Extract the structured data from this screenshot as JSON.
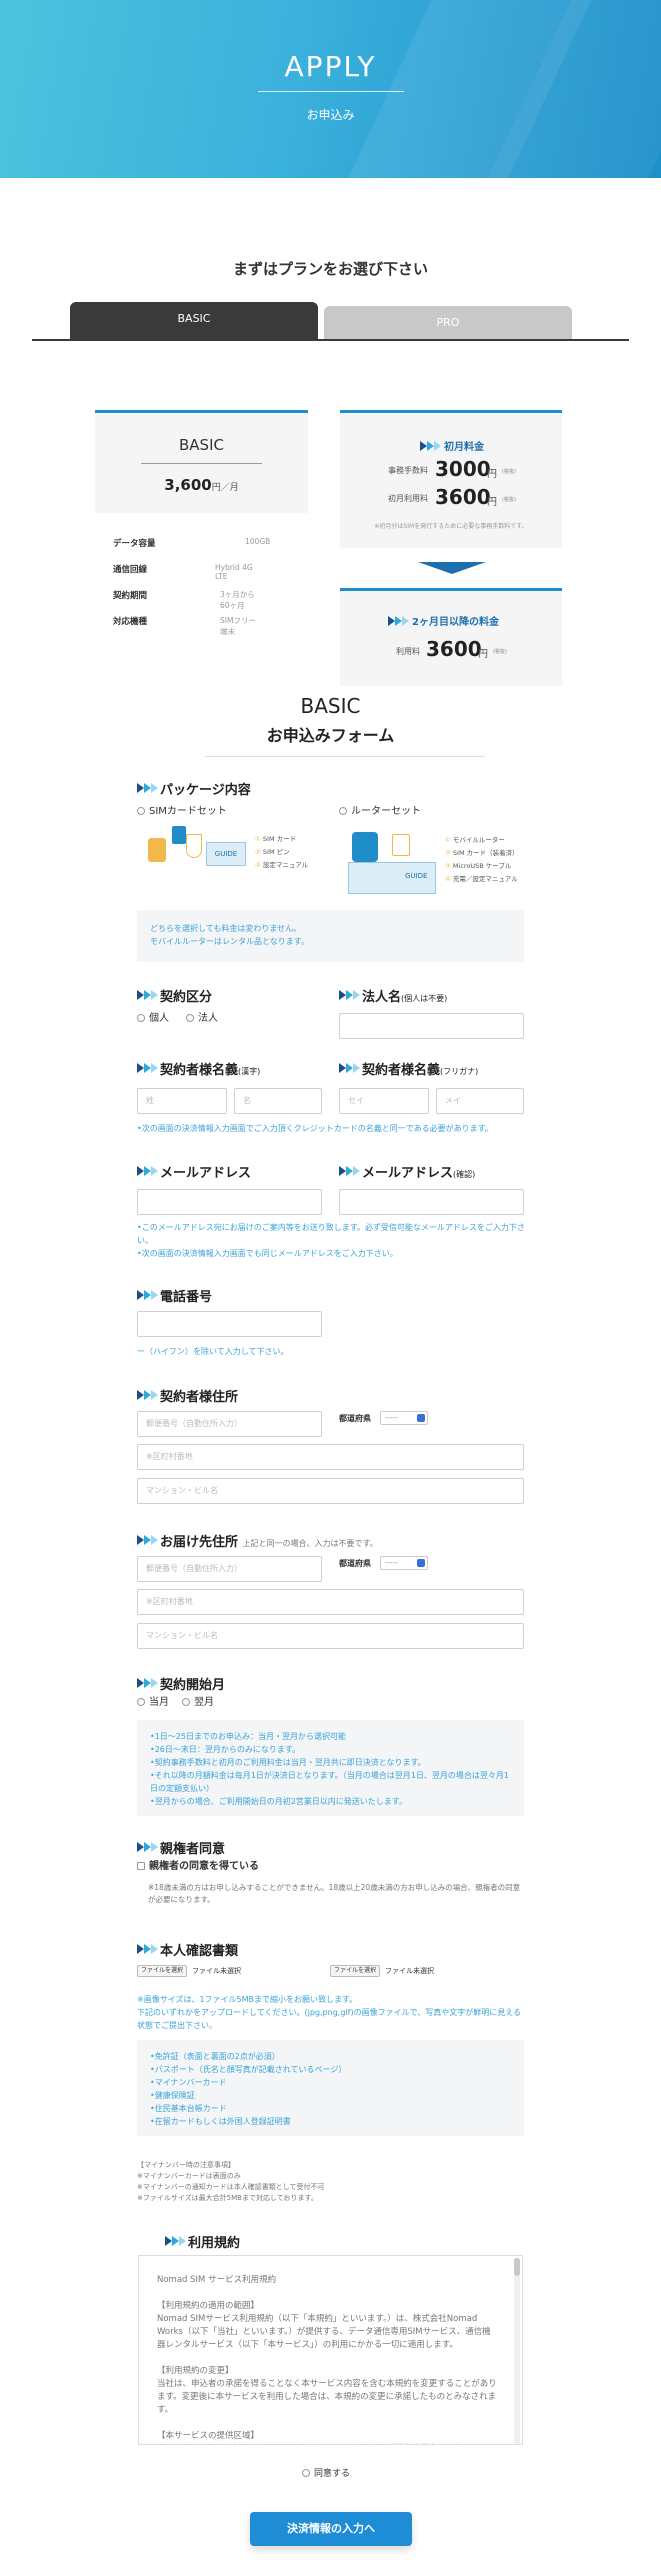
{
  "hero": {
    "title": "APPLY",
    "subtitle": "お申込み"
  },
  "plan_select": {
    "heading": "まずはプランをお選び下さい"
  },
  "tabs": [
    {
      "label": "BASIC"
    },
    {
      "label": "PRO"
    }
  ],
  "plan_card": {
    "name": "BASIC",
    "price": "3,600",
    "price_unit": "円／月",
    "rows": [
      {
        "key": "データ容量",
        "value": "100GB"
      },
      {
        "key": "通信回線",
        "value": "Hybrid 4G LTE"
      },
      {
        "key": "契約期間",
        "value": "3ヶ月から60ヶ月"
      },
      {
        "key": "対応機種",
        "value": "SIMフリー端末"
      }
    ]
  },
  "initial_fee": {
    "title": "初月料金",
    "admin_label": "事務手数料",
    "admin_value": "3000",
    "usage_label": "初月利用料",
    "usage_value": "3600",
    "yen": "円",
    "tax": "(税抜)",
    "note": "※初月分はSIMを発行するために必要な事務手数料です。"
  },
  "monthly_fee": {
    "title": "2ヶ月目以降の料金",
    "label": "利用料",
    "value": "3600",
    "yen": "円",
    "tax": "(税抜)"
  },
  "form": {
    "title1": "BASIC",
    "title2": "お申込みフォーム"
  },
  "package": {
    "heading": "パッケージ内容",
    "option_sim": "SIMカードセット",
    "option_router": "ルーターセット",
    "sim_items": [
      "SIM カード",
      "SIM ピン",
      "設定マニュアル"
    ],
    "router_items": [
      "モバイルルーター",
      "SIM カード（装着済）",
      "MicroUSB ケーブル",
      "充電／設定マニュアル"
    ],
    "guide": "GUIDE",
    "note": "どちらを選択しても料金は変わりません。\nモバイルルーターはレンタル品となります。"
  },
  "contract_type": {
    "heading": "契約区分",
    "options": [
      "個人",
      "法人"
    ]
  },
  "company_name": {
    "heading": "法人名",
    "sub": "(個人は不要)"
  },
  "name_kanji": {
    "heading": "契約者様名義",
    "sub": "(漢字)",
    "last_placeholder": "姓",
    "first_placeholder": "名"
  },
  "name_kana": {
    "heading": "契約者様名義",
    "sub": "(フリガナ)",
    "last_placeholder": "セイ",
    "first_placeholder": "メイ"
  },
  "name_note": "•次の画面の決済情報入力画面でご入力頂くクレジットカードの名義と同一である必要があります。",
  "email": {
    "heading": "メールアドレス",
    "confirm_heading": "メールアドレス",
    "confirm_sub": "(確認)",
    "note": "•このメールアドレス宛にお届けのご案内等をお送り致します。必ず受信可能なメールアドレスをご入力下さい。\n•次の画面の決済情報入力画面でも同じメールアドレスをご入力下さい。"
  },
  "phone": {
    "heading": "電話番号",
    "note": "ー（ハイフン）を除いて入力して下さい。"
  },
  "address": {
    "heading": "契約者様住所",
    "zip_placeholder": "郵便番号（自動住所入力）",
    "pref_label": "都道府県",
    "pref_value": "-----",
    "city_placeholder": "※区町村番地",
    "building_placeholder": "マンション・ビル名"
  },
  "delivery": {
    "heading": "お届け先住所",
    "sub": "上記と同一の場合、入力は不要です。",
    "zip_placeholder": "郵便番号（自動住所入力）",
    "pref_label": "都道府県",
    "pref_value": "-----",
    "city_placeholder": "※区町村番地",
    "building_placeholder": "マンション・ビル名"
  },
  "start_month": {
    "heading": "契約開始月",
    "options": [
      "当月",
      "翌月"
    ],
    "note": "•1日〜25日までのお申込み：当月・翌月から選択可能\n•26日〜末日：翌月からのみになります。\n•契約事務手数料と初月のご利用料金は当月・翌月共に即日決済となります。\n•それ以降の月額料金は毎月1日が決済日となります。（当月の場合は翌月1日、翌月の場合は翌々月1日の定額支払い）\n•翌月からの場合、ご利用開始日の月初2営業日以内に発送いたします。"
  },
  "parent": {
    "heading": "親権者同意",
    "checkbox": "親権者の同意を得ている",
    "note": "※18歳未満の方はお申し込みすることができません。18歳以上20歳未満の方お申し込みの場合、親権者の同意が必要になります。"
  },
  "identity": {
    "heading": "本人確認書類",
    "file_button": "ファイルを選択",
    "file_status": "ファイル未選択",
    "note": "※画像サイズは、1ファイル5MBまで縮小をお願い致します。\n下記のいずれかをアップロードしてください。(jpg,png,gif)の画像ファイルで、写真や文字が鮮明に見える状態でご提出下さい。",
    "list": "•免許証（表面と裏面の2点が必須）\n•パスポート（氏名と顔写真が記載されているページ）\n•マイナンバーカード\n•健康保険証\n•住民基本台帳カード\n•在留カードもしくは外国人登録証明書",
    "mynumber_note": "【マイナンバー時の注意事項】\n※マイナンバーカードは表面のみ\n※マイナンバーの通知カードは本人確認書類として受付不可\n※ファイルサイズは最大合計5MBまで対応しております。"
  },
  "terms": {
    "heading": "利用規約",
    "body": "Nomad SIM サービス利用規約\n\n【利用規約の適用の範囲】\nNomad SIMサービス利用規約（以下「本規約」といいます。）は、株式会社Nomad Works（以下「当社」といいます。）が提供する、データ通信専用SIMサービス、通信機器レンタルサービス（以下「本サービス」）の利用にかかる一切に適用します。\n\n【利用規約の変更】\n当社は、申込者の承諾を得ることなく本サービス内容を含む本規約を変更することがあります。変更後に本サービスを利用した場合は、本規約の変更に承諾したものとみなされます。\n\n【本サービスの提供区域】\n本サービスの提供区域は、通信回線に接続されうる端末機器が設定事業者の通信",
    "agree": "同意する"
  },
  "submit": {
    "label": "決済情報の入力へ"
  },
  "colors": {
    "accent": "#1e8dc8",
    "note_blue": "#3aa3d9",
    "tab_active": "#3a3a3a",
    "tab_inactive": "#c9c9c9"
  }
}
